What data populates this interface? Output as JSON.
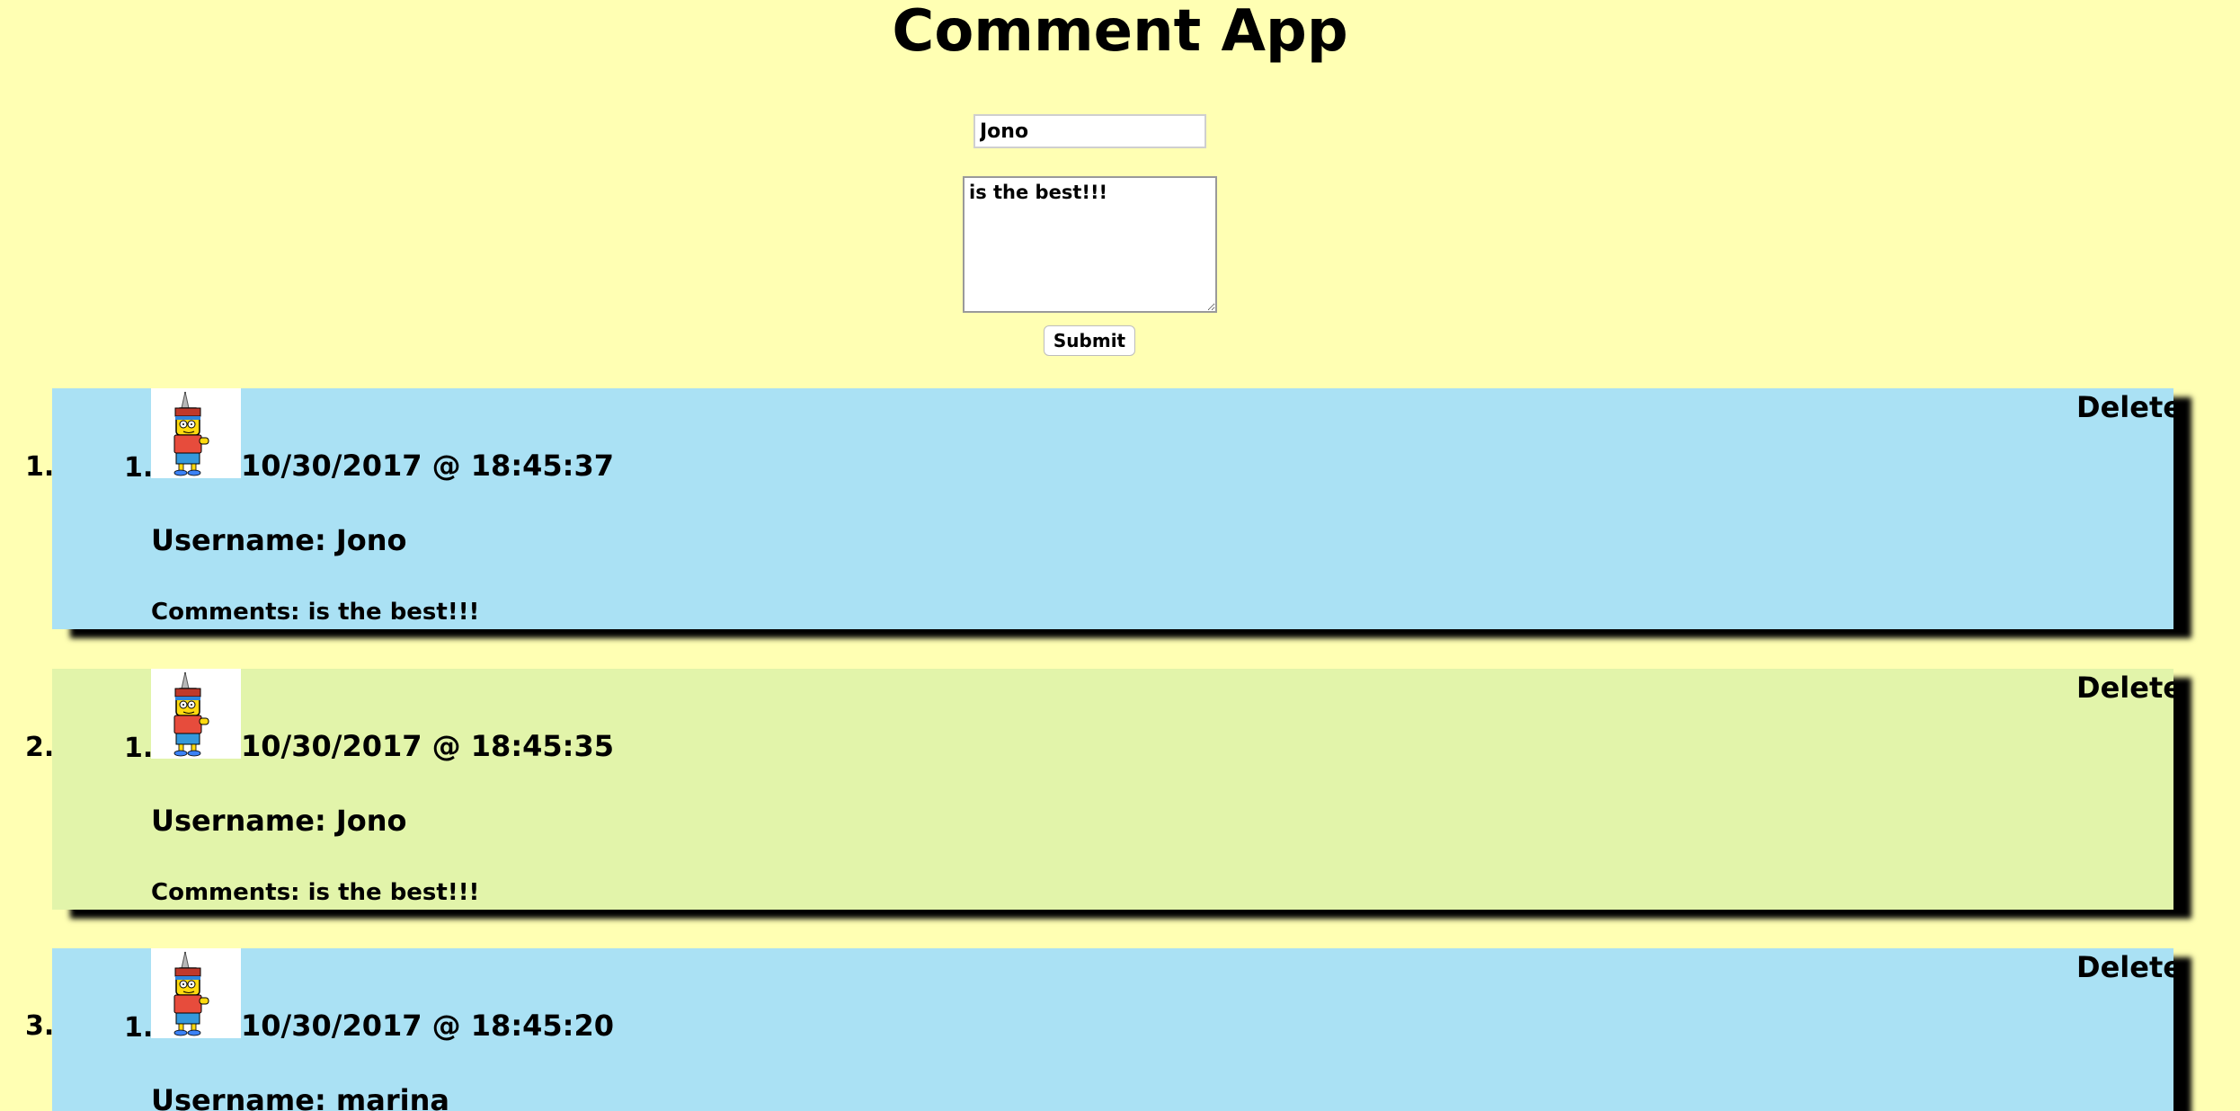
{
  "app": {
    "title": "Comment App"
  },
  "form": {
    "username_value": "Jono",
    "comment_value": "is the best!!!",
    "submit_label": "Submit"
  },
  "comments": [
    {
      "index": "1.",
      "inner_index": "1.",
      "timestamp": "10/30/2017 @ 18:45:37",
      "username_line": "Username: Jono",
      "comments_line": "Comments: is the best!!!",
      "delete_label": "Delete",
      "bg_color": "#aae1f4"
    },
    {
      "index": "2.",
      "inner_index": "1.",
      "timestamp": "10/30/2017 @ 18:45:35",
      "username_line": "Username: Jono",
      "comments_line": "Comments: is the best!!!",
      "delete_label": "Delete",
      "bg_color": "#e2f4aa"
    },
    {
      "index": "3.",
      "inner_index": "1.",
      "timestamp": "10/30/2017 @ 18:45:20",
      "username_line": "Username: marina",
      "comments_line": "",
      "delete_label": "Delete",
      "bg_color": "#aae1f4"
    }
  ],
  "colors": {
    "page_background": "#ffffb3",
    "card_blue": "#aae1f4",
    "card_green": "#e2f4aa"
  },
  "icons": {
    "avatar": "bart-simpson-avatar-icon"
  }
}
